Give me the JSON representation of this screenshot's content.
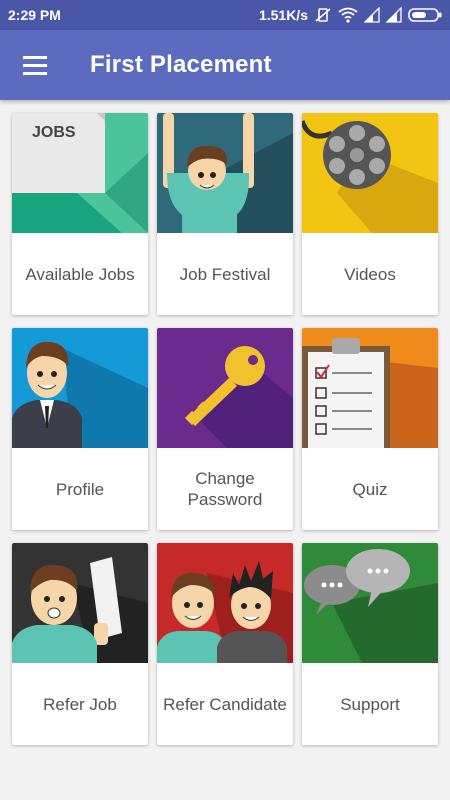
{
  "status_bar": {
    "time": "2:29 PM",
    "speed": "1.51K/s",
    "icons": [
      "vibrate-off-icon",
      "wifi-icon",
      "signal-icon",
      "signal-icon",
      "battery-icon"
    ]
  },
  "app_bar": {
    "menu_icon": "hamburger-menu-icon",
    "title": "First Placement"
  },
  "tiles": [
    {
      "label": "Available Jobs",
      "art_text": "JOBS",
      "color": "#1aa37f"
    },
    {
      "label": "Job Festival",
      "color": "#2e6a7a"
    },
    {
      "label": "Videos",
      "color": "#f3c513"
    },
    {
      "label": "Profile",
      "color": "#159ad8"
    },
    {
      "label_line1": "Change",
      "label_line2": "Password",
      "color": "#6a2a8e"
    },
    {
      "label": "Quiz",
      "color": "#f08a1b"
    },
    {
      "label": "Refer Job",
      "color": "#333333"
    },
    {
      "label": "Refer Candidate",
      "color": "#c62a28"
    },
    {
      "label": "Support",
      "color": "#2f8a3a"
    }
  ]
}
